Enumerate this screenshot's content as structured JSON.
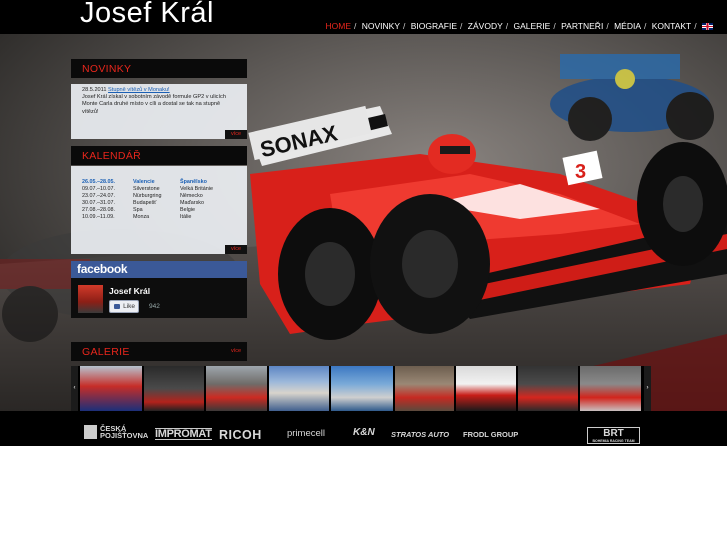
{
  "header": {
    "site_title": "Josef Král",
    "nav": [
      {
        "label": "HOME",
        "active": true
      },
      {
        "label": "NOVINKY",
        "active": false
      },
      {
        "label": "BIOGRAFIE",
        "active": false
      },
      {
        "label": "ZÁVODY",
        "active": false
      },
      {
        "label": "GALERIE",
        "active": false
      },
      {
        "label": "PARTNEŘI",
        "active": false
      },
      {
        "label": "MÉDIA",
        "active": false
      },
      {
        "label": "KONTAKT",
        "active": false
      }
    ],
    "language_icon": "uk-flag-icon"
  },
  "news": {
    "title": "NOVINKY",
    "date": "28.5.2011",
    "headline": "Stupně vítězů v Monaku!",
    "text": "Josef Král získal v sobotním závodě formule GP2 v ulicích Monte Carla druhé místo v cíli a dostal se tak na stupně vítězů!",
    "more": "více"
  },
  "calendar": {
    "title": "KALENDÁŘ",
    "rows": [
      {
        "date": "26.05.–28.05.",
        "place": "Valencie",
        "country": "Španělsko",
        "highlight": true
      },
      {
        "date": "09.07.–10.07.",
        "place": "Silverstone",
        "country": "Velká Británie",
        "highlight": false
      },
      {
        "date": "23.07.–24.07.",
        "place": "Nürburgring",
        "country": "Německo",
        "highlight": false
      },
      {
        "date": "30.07.–31.07.",
        "place": "Budapešť",
        "country": "Maďarsko",
        "highlight": false
      },
      {
        "date": "27.08.–28.08.",
        "place": "Spa",
        "country": "Belgie",
        "highlight": false
      },
      {
        "date": "10.09.–11.09.",
        "place": "Monza",
        "country": "Itálie",
        "highlight": false
      }
    ],
    "more": "více"
  },
  "facebook": {
    "brand": "facebook",
    "name": "Josef Král",
    "like_label": "Like",
    "like_count": "942"
  },
  "gallery": {
    "title": "GALERIE",
    "more": "více",
    "prev_glyph": "‹",
    "next_glyph": "›"
  },
  "hero": {
    "sponsor_on_car": "SONAX",
    "car_number": "3"
  },
  "sponsors": {
    "ceska_line1": "ČESKÁ",
    "ceska_line2": "POJIŠŤOVNA",
    "impromat": "IMPROMAT",
    "ricoh": "RICOH",
    "primecell": "primecell",
    "kn": "K&N",
    "stratos": "STRATOS AUTO",
    "frodl": "FRODL GROUP",
    "brt": "BRT",
    "brt_sub": "BOHEMIA RACING TEAM"
  },
  "colors": {
    "accent": "#e8261c",
    "facebook": "#3b5998",
    "link": "#1a5fb4"
  }
}
